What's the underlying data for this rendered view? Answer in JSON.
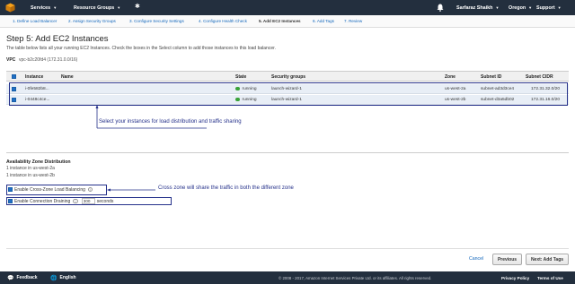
{
  "nav": {
    "services": "Services",
    "resource_groups": "Resource Groups",
    "user": "Sarfaraz Shaikh",
    "region": "Oregon",
    "support": "Support"
  },
  "wizard_tabs": [
    "1. Define Load Balancer",
    "2. Assign Security Groups",
    "3. Configure Security Settings",
    "4. Configure Health Check",
    "5. Add EC2 Instances",
    "6. Add Tags",
    "7. Review"
  ],
  "page": {
    "title": "Step 5: Add EC2 Instances",
    "description": "The table below lists all your running EC2 Instances. Check the boxes in the Select column to add those instances to this load balancer.",
    "vpc_label": "VPC",
    "vpc_value": "vpc-b2c20fd4 (172.31.0.0/16)"
  },
  "table": {
    "headers": [
      "Instance",
      "Name",
      "State",
      "Security groups",
      "Zone",
      "Subnet ID",
      "Subnet CIDR"
    ],
    "rows": [
      {
        "instance": "i-0fe582b8...",
        "name": "",
        "state": "running",
        "security_group": "launch-wizard-1",
        "zone": "us-west-2a",
        "subnet_id": "subnet-ad3d3ce4",
        "subnet_cidr": "172.31.32.0/20"
      },
      {
        "instance": "i-0448c4ce...",
        "name": "",
        "state": "running",
        "security_group": "launch-wizard-1",
        "zone": "us-west-2b",
        "subnet_id": "subnet-d3a5db02",
        "subnet_cidr": "172.31.16.0/20"
      }
    ]
  },
  "annotations": {
    "select_instances": "Select your instances for load distribution and traffic sharing",
    "cross_zone": "Cross zone will share the traffic in both the different zone"
  },
  "availability": {
    "title": "Availability Zone Distribution",
    "lines": [
      "1 instance in us-west-2a",
      "1 instance in us-west-2b"
    ]
  },
  "options": {
    "cross_zone_label": "Enable Cross-Zone Load Balancing",
    "cross_zone_checked": true,
    "draining_label": "Enable Connection Draining",
    "draining_checked": true,
    "draining_value": "300",
    "draining_unit": "seconds"
  },
  "buttons": {
    "cancel": "Cancel",
    "previous": "Previous",
    "next": "Next: Add Tags"
  },
  "footer": {
    "feedback": "Feedback",
    "language": "English",
    "copyright": "© 2008 - 2017, Amazon Internet Services Private Ltd. or its affiliates. All rights reserved.",
    "privacy": "Privacy Policy",
    "terms": "Terms of Use"
  },
  "colors": {
    "nav_bg": "#232f3e",
    "link": "#1166bb",
    "highlight": "#24308a",
    "running": "#3aa33a",
    "cube": "#f7a11a"
  }
}
